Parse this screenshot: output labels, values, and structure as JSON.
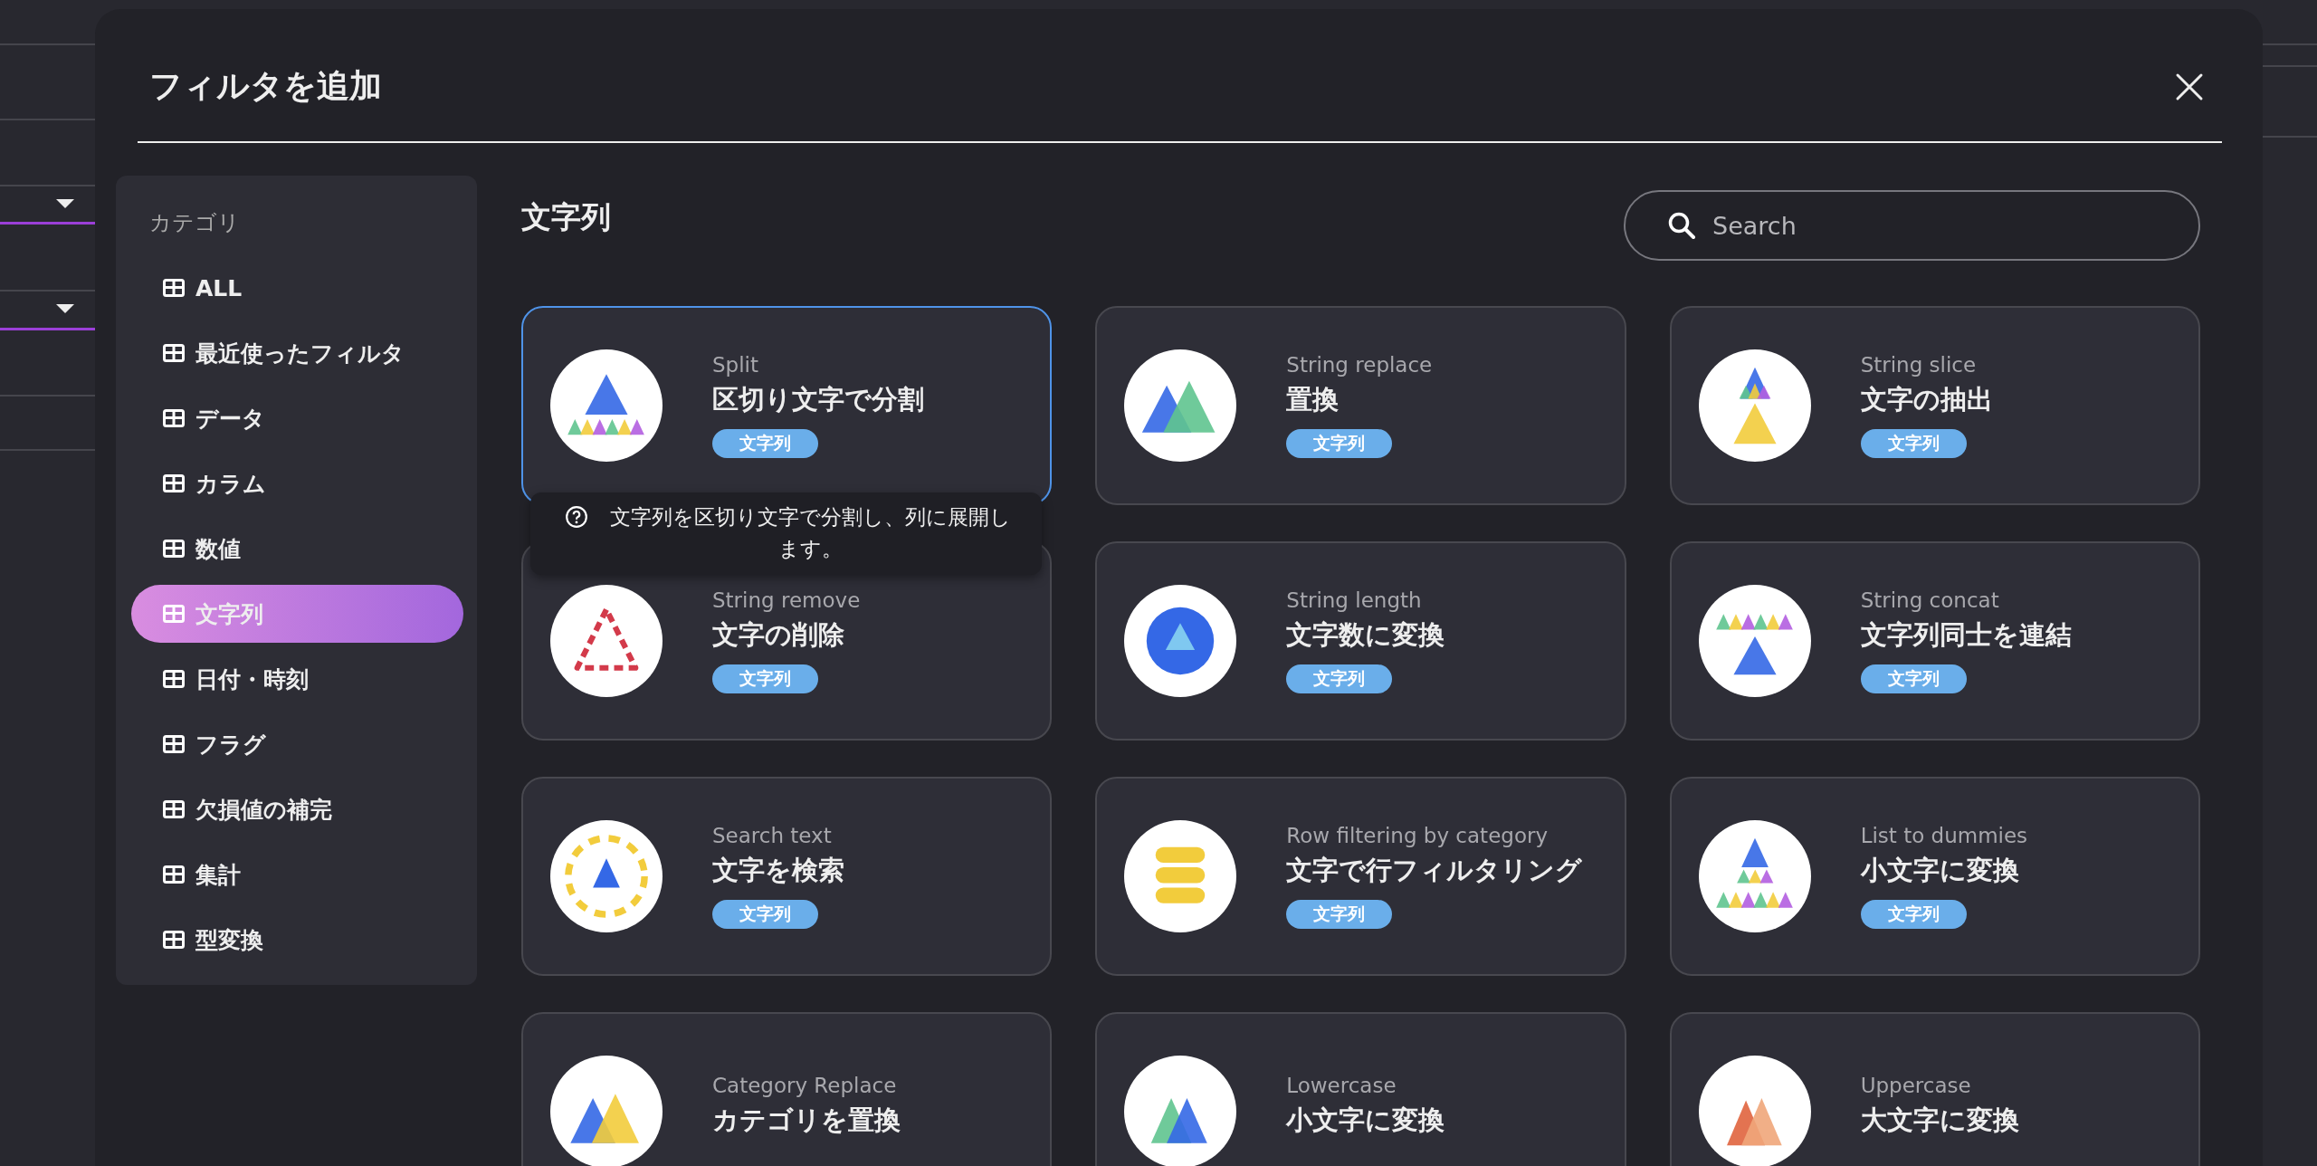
{
  "dialog": {
    "title": "フィルタを追加"
  },
  "sidebar": {
    "heading": "カテゴリ",
    "items": [
      {
        "label": "ALL",
        "selected": false
      },
      {
        "label": "最近使ったフィルタ",
        "selected": false
      },
      {
        "label": "データ",
        "selected": false
      },
      {
        "label": "カラム",
        "selected": false
      },
      {
        "label": "数値",
        "selected": false
      },
      {
        "label": "文字列",
        "selected": true
      },
      {
        "label": "日付・時刻",
        "selected": false
      },
      {
        "label": "フラグ",
        "selected": false
      },
      {
        "label": "欠損値の補完",
        "selected": false
      },
      {
        "label": "集計",
        "selected": false
      },
      {
        "label": "型変換",
        "selected": false
      }
    ]
  },
  "content": {
    "heading": "文字列",
    "search": {
      "placeholder": "Search"
    },
    "cards": [
      {
        "name": "Split",
        "title": "区切り文字で分割",
        "tag": "文字列",
        "selected": true,
        "tooltip": "文字列を区切り文字で分割し、列に展開します。"
      },
      {
        "name": "String replace",
        "title": "置換",
        "tag": "文字列",
        "selected": false
      },
      {
        "name": "String slice",
        "title": "文字の抽出",
        "tag": "文字列",
        "selected": false
      },
      {
        "name": "String remove",
        "title": "文字の削除",
        "tag": "文字列",
        "selected": false
      },
      {
        "name": "String length",
        "title": "文字数に変換",
        "tag": "文字列",
        "selected": false
      },
      {
        "name": "String concat",
        "title": "文字列同士を連結",
        "tag": "文字列",
        "selected": false
      },
      {
        "name": "Search text",
        "title": "文字を検索",
        "tag": "文字列",
        "selected": false
      },
      {
        "name": "Row filtering by category",
        "title": "文字で行フィルタリング",
        "tag": "文字列",
        "selected": false
      },
      {
        "name": "List to dummies",
        "title": "小文字に変換",
        "tag": "文字列",
        "selected": false
      },
      {
        "name": "Category Replace",
        "title": "カテゴリを置換",
        "selected": false
      },
      {
        "name": "Lowercase",
        "title": "小文字に変換",
        "selected": false
      },
      {
        "name": "Uppercase",
        "title": "大文字に変換",
        "selected": false
      }
    ]
  }
}
